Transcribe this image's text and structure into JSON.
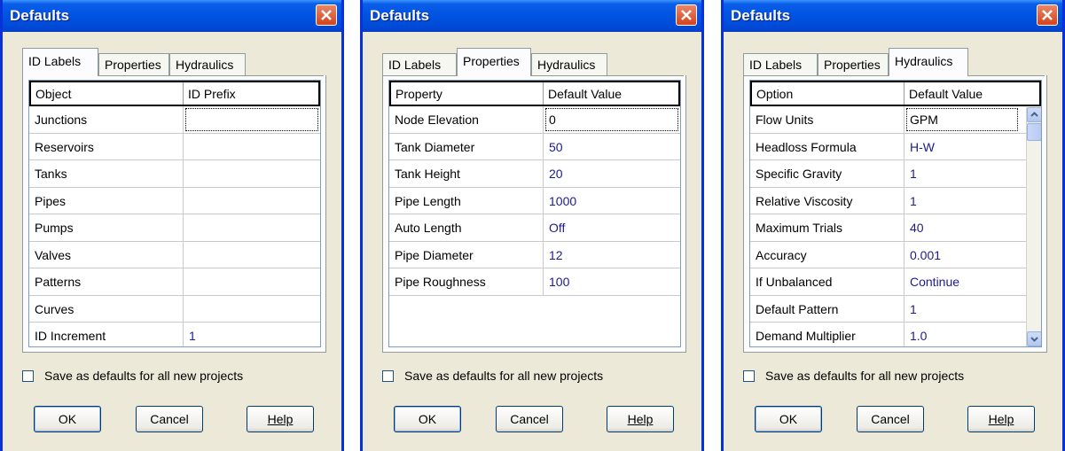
{
  "dialogs": [
    {
      "title": "Defaults",
      "tabs": [
        "ID Labels",
        "Properties",
        "Hydraulics"
      ],
      "active_tab": 0,
      "columns": [
        "Object",
        "ID Prefix"
      ],
      "rows": [
        [
          "Junctions",
          ""
        ],
        [
          "Reservoirs",
          ""
        ],
        [
          "Tanks",
          ""
        ],
        [
          "Pipes",
          ""
        ],
        [
          "Pumps",
          ""
        ],
        [
          "Valves",
          ""
        ],
        [
          "Patterns",
          ""
        ],
        [
          "Curves",
          ""
        ],
        [
          "ID Increment",
          "1"
        ]
      ],
      "checkbox_label": "Save as defaults for all new projects",
      "buttons": {
        "ok": "OK",
        "cancel": "Cancel",
        "help": "Help"
      }
    },
    {
      "title": "Defaults",
      "tabs": [
        "ID Labels",
        "Properties",
        "Hydraulics"
      ],
      "active_tab": 1,
      "columns": [
        "Property",
        "Default Value"
      ],
      "rows": [
        [
          "Node Elevation",
          "0"
        ],
        [
          "Tank Diameter",
          "50"
        ],
        [
          "Tank Height",
          "20"
        ],
        [
          "Pipe Length",
          "1000"
        ],
        [
          "Auto Length",
          "Off"
        ],
        [
          "Pipe Diameter",
          "12"
        ],
        [
          "Pipe Roughness",
          "100"
        ]
      ],
      "checkbox_label": "Save as defaults for all new projects",
      "buttons": {
        "ok": "OK",
        "cancel": "Cancel",
        "help": "Help"
      }
    },
    {
      "title": "Defaults",
      "tabs": [
        "ID Labels",
        "Properties",
        "Hydraulics"
      ],
      "active_tab": 2,
      "columns": [
        "Option",
        "Default Value"
      ],
      "rows": [
        [
          "Flow Units",
          "GPM"
        ],
        [
          "Headloss Formula",
          "H-W"
        ],
        [
          "Specific Gravity",
          "1"
        ],
        [
          "Relative Viscosity",
          "1"
        ],
        [
          "Maximum Trials",
          "40"
        ],
        [
          "Accuracy",
          "0.001"
        ],
        [
          "If Unbalanced",
          "Continue"
        ],
        [
          "Default Pattern",
          "1"
        ],
        [
          "Demand Multiplier",
          "1.0"
        ]
      ],
      "checkbox_label": "Save as defaults for all new projects",
      "buttons": {
        "ok": "OK",
        "cancel": "Cancel",
        "help": "Help"
      }
    }
  ],
  "colors": {
    "titlebar": "#0053e1",
    "dialog_bg": "#ece9d8",
    "value_text": "#1b1b8f",
    "close_button": "#d4431c"
  },
  "icons": [
    "close-icon",
    "checkbox-icon",
    "scroll-up-icon",
    "scroll-down-icon"
  ]
}
